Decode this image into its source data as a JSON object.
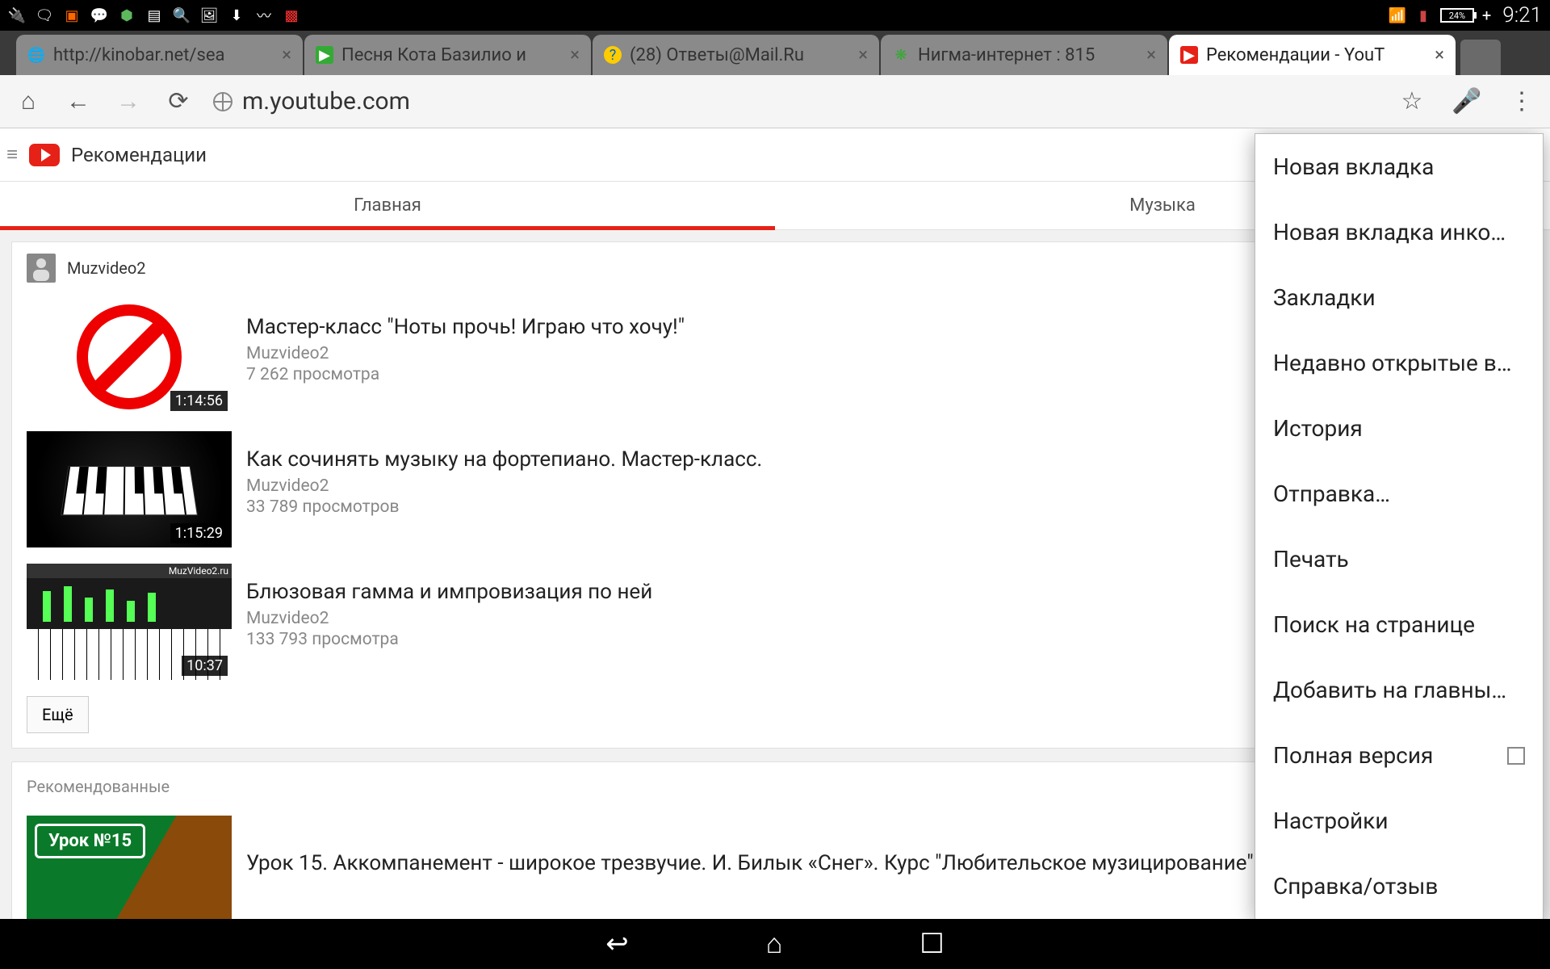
{
  "status_bar": {
    "battery_text": "24%",
    "clock": "9:21"
  },
  "tabs": [
    {
      "title": "http://kinobar.net/sea",
      "favicon": "globe"
    },
    {
      "title": "Песня Кота Базилио и",
      "favicon": "play-green"
    },
    {
      "title": "(28) Ответы@Mail.Ru",
      "favicon": "mail-q"
    },
    {
      "title": "Нигма-интернет : 815",
      "favicon": "nigma"
    },
    {
      "title": "Рекомендации - YouT",
      "favicon": "youtube",
      "active": true
    }
  ],
  "address_bar": {
    "url": "m.youtube.com"
  },
  "youtube": {
    "header_title": "Рекомендации",
    "tab_main": "Главная",
    "tab_music": "Музыка",
    "channel_name": "Muzvideo2",
    "videos": [
      {
        "title": "Мастер-класс \"Ноты прочь! Играю что хочу!\"",
        "channel": "Muzvideo2",
        "views": "7 262 просмотра",
        "duration": "1:14:56"
      },
      {
        "title": "Как сочинять музыку на фортепиано. Мастер-класс.",
        "channel": "Muzvideo2",
        "views": "33 789 просмотров",
        "duration": "1:15:29"
      },
      {
        "title": "Блюзовая гамма и импровизация по ней",
        "channel": "Muzvideo2",
        "views": "133 793 просмотра",
        "duration": "10:37"
      }
    ],
    "more_button": "Ещё",
    "section2_title": "Рекомендованные",
    "video4_title": "Урок 15. Аккомпанемент - широкое трезвучие. И. Билык «Снег». Курс \"Любительское музицирование\".",
    "video4_badge": "Урок №15",
    "video3_brand": "MuzVideo2.ru"
  },
  "chrome_menu": {
    "items": [
      "Новая вкладка",
      "Новая вкладка инко…",
      "Закладки",
      "Недавно открытые в…",
      "История",
      "Отправка…",
      "Печать",
      "Поиск на странице",
      "Добавить на главны…",
      "Полная версия",
      "Настройки",
      "Справка/отзыв"
    ]
  }
}
